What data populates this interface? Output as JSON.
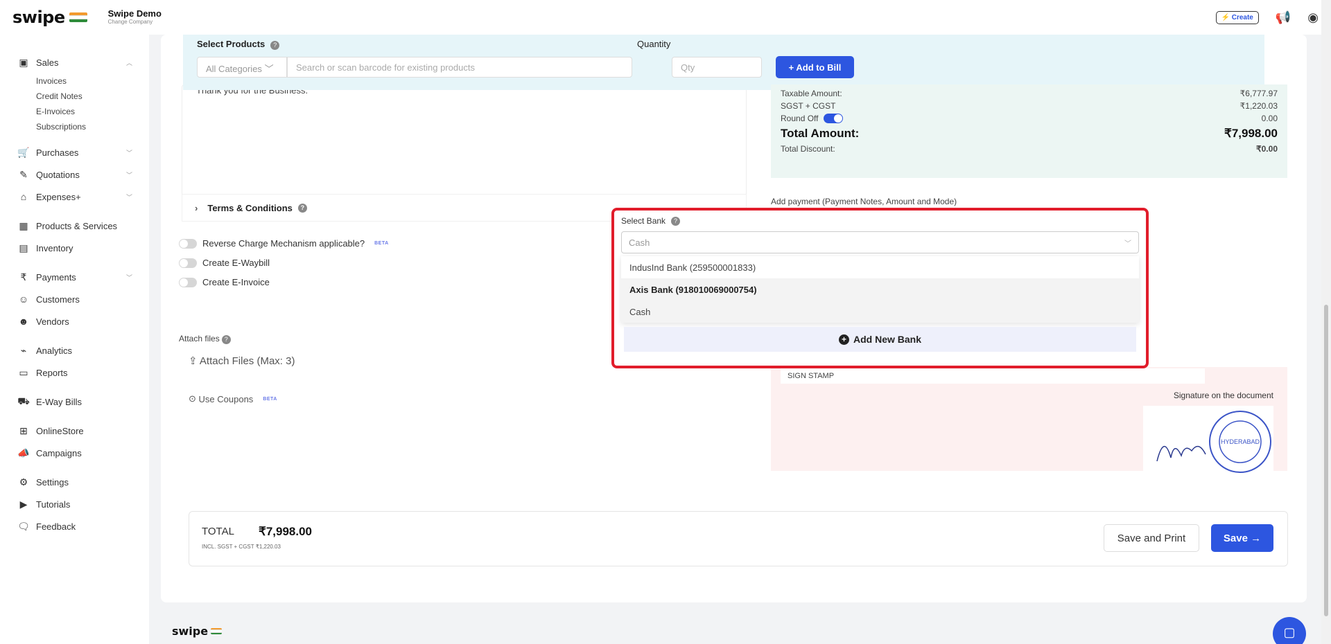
{
  "topbar": {
    "logo_text": "swipe",
    "company_name": "Swipe Demo",
    "company_sub": "Change Company",
    "create_label": "⚡ Create"
  },
  "sidebar": {
    "sales": "Sales",
    "sales_sub": [
      "Invoices",
      "Credit Notes",
      "E-Invoices",
      "Subscriptions"
    ],
    "items": [
      {
        "label": "Purchases"
      },
      {
        "label": "Quotations"
      },
      {
        "label": "Expenses+"
      },
      {
        "label": "Products & Services"
      },
      {
        "label": "Inventory"
      },
      {
        "label": "Payments"
      },
      {
        "label": "Customers"
      },
      {
        "label": "Vendors"
      },
      {
        "label": "Analytics"
      },
      {
        "label": "Reports"
      },
      {
        "label": "E-Way Bills"
      },
      {
        "label": "OnlineStore"
      },
      {
        "label": "Campaigns"
      },
      {
        "label": "Settings"
      },
      {
        "label": "Tutorials"
      },
      {
        "label": "Feedback"
      }
    ]
  },
  "products": {
    "label": "Select Products",
    "quantity_label": "Quantity",
    "category": "All Categories",
    "search_placeholder": "Search or scan barcode for existing products",
    "qty_placeholder": "Qty",
    "add_button": "+ Add to Bill"
  },
  "notes": {
    "text": "Thank you for the Business."
  },
  "terms_label": "Terms & Conditions",
  "options": {
    "reverse_charge": "Reverse Charge Mechanism applicable?",
    "beta": "BETA",
    "ewaybill": "Create E-Waybill",
    "einvoice": "Create E-Invoice",
    "attach_label": "Attach files",
    "attach_button": "Attach Files (Max: 3)",
    "coupons": "Use Coupons"
  },
  "summary": {
    "taxable_label": "Taxable Amount:",
    "taxable_value": "₹6,777.97",
    "tax_label": "SGST + CGST",
    "tax_value": "₹1,220.03",
    "round_label": "Round Off",
    "round_value": "0.00",
    "total_label": "Total Amount:",
    "total_value": "₹7,998.00",
    "discount_label": "Total Discount:",
    "discount_value": "₹0.00"
  },
  "payment": {
    "add_label": "Add payment (Payment Notes, Amount and Mode)",
    "select_bank_label": "Select Bank",
    "selected_value": "Cash",
    "options": [
      "IndusInd Bank (259500001833)",
      "Axis Bank (918010069000754)",
      "Cash"
    ],
    "add_new_bank": "Add New Bank"
  },
  "signature": {
    "stamp_value": "SIGN STAMP",
    "caption": "Signature on the document",
    "stamp_text": "HYDERABAD"
  },
  "footer": {
    "total_label": "TOTAL",
    "total_value": "₹7,998.00",
    "tax_note": "INCL. SGST + CGST   ₹1,220.03",
    "save_print": "Save and Print",
    "save": "Save →",
    "logo_text": "swipe"
  },
  "colors": {
    "accent": "#2d56e0",
    "highlight_border": "#e11d2b"
  }
}
